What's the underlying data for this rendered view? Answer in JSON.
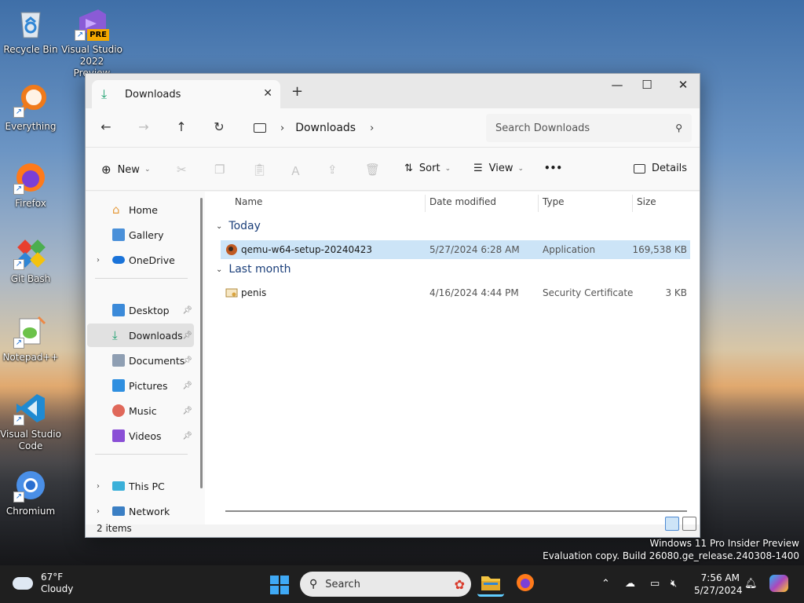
{
  "desktop": {
    "icons": [
      {
        "label": "Recycle Bin",
        "icon": "recycle-bin-icon"
      },
      {
        "label": "Visual Studio 2022 Preview",
        "icon": "visual-studio-icon",
        "badge": "PRE"
      },
      {
        "label": "Everything",
        "icon": "everything-search-icon"
      },
      {
        "label": "Firefox",
        "icon": "firefox-icon"
      },
      {
        "label": "Git Bash",
        "icon": "git-bash-icon"
      },
      {
        "label": "Notepad++",
        "icon": "notepad-plus-plus-icon"
      },
      {
        "label": "Visual Studio Code",
        "icon": "vscode-icon"
      },
      {
        "label": "Chromium",
        "icon": "chromium-icon"
      }
    ],
    "watermark": {
      "line1": "Windows 11 Pro Insider Preview",
      "line2": "Evaluation copy. Build 26080.ge_release.240308-1400"
    }
  },
  "explorer": {
    "tab": {
      "label": "Downloads",
      "close": "✕",
      "new_tab": "+"
    },
    "window_controls": {
      "minimize": "—",
      "maximize": "☐",
      "close": "✕"
    },
    "nav": {
      "back": "←",
      "forward": "→",
      "up": "↑",
      "refresh": "↻"
    },
    "address": {
      "crumb": "Downloads",
      "separator": "›"
    },
    "search": {
      "placeholder": "Search Downloads"
    },
    "toolbar": {
      "new_label": "New",
      "sort_label": "Sort",
      "view_label": "View",
      "more_label": "•••",
      "details_label": "Details"
    },
    "sidebar": {
      "items": [
        {
          "label": "Home"
        },
        {
          "label": "Gallery"
        },
        {
          "label": "OneDrive"
        },
        {
          "label": "Desktop"
        },
        {
          "label": "Downloads"
        },
        {
          "label": "Documents"
        },
        {
          "label": "Pictures"
        },
        {
          "label": "Music"
        },
        {
          "label": "Videos"
        },
        {
          "label": "This PC"
        },
        {
          "label": "Network"
        }
      ]
    },
    "columns": {
      "name": "Name",
      "date": "Date modified",
      "type": "Type",
      "size": "Size"
    },
    "groups": [
      {
        "label": "Today",
        "files": [
          {
            "name": "qemu-w64-setup-20240423",
            "date": "5/27/2024 6:28 AM",
            "type": "Application",
            "size": "169,538 KB"
          }
        ]
      },
      {
        "label": "Last month",
        "files": [
          {
            "name": "penis",
            "date": "4/16/2024 4:44 PM",
            "type": "Security Certificate",
            "size": "3 KB"
          }
        ]
      }
    ],
    "status": {
      "items": "2 items"
    }
  },
  "taskbar": {
    "weather": {
      "temp": "67°F",
      "condition": "Cloudy"
    },
    "search_label": "Search",
    "clock": {
      "time": "7:56 AM",
      "date": "5/27/2024"
    }
  },
  "colors": {
    "accent": "#0078d4",
    "selection": "#cce4f7",
    "taskbar": "#1f1f1f"
  }
}
